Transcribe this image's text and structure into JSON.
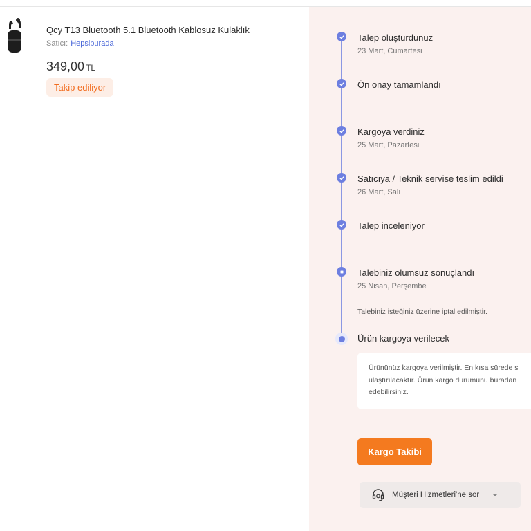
{
  "product": {
    "title": "Qcy T13 Bluetooth 5.1 Bluetooth Kablosuz Kulaklık",
    "seller_label": "Satıcı:",
    "seller_name": "Hepsiburada",
    "price": "349,00",
    "currency": "TL",
    "status_badge": "Takip ediliyor",
    "image_icon": "earbuds-case-icon"
  },
  "timeline": {
    "steps": [
      {
        "title": "Talep oluşturdunuz",
        "date": "23 Mart, Cumartesi",
        "status": "done"
      },
      {
        "title": "Ön onay tamamlandı",
        "date": "",
        "status": "done"
      },
      {
        "title": "Kargoya verdiniz",
        "date": "25 Mart, Pazartesi",
        "status": "done"
      },
      {
        "title": "Satıcıya / Teknik servise teslim edildi",
        "date": "26 Mart, Salı",
        "status": "done"
      },
      {
        "title": "Talep inceleniyor",
        "date": "",
        "status": "done"
      },
      {
        "title": "Talebiniz olumsuz sonuçlandı",
        "date": "25 Nisan, Perşembe",
        "note": "Talebiniz isteğiniz üzerine iptal edilmiştir.",
        "status": "rejected"
      },
      {
        "title": "Ürün kargoya verilecek",
        "status": "current"
      }
    ],
    "info_lines": [
      "Ürününüz kargoya verilmiştir. En kısa sürede s",
      "ulaştırılacaktır. Ürün kargo durumunu buradan",
      "edebilirsiniz."
    ]
  },
  "actions": {
    "cargo_button": "Kargo Takibi",
    "support_button": "Müşteri Hizmetleri'ne sor",
    "support_icon": "headset-icon"
  },
  "colors": {
    "accent_orange": "#f47a1f",
    "timeline_blue": "#6d7fe0",
    "seller_link": "#4a67d8",
    "panel_bg": "#fbf1ef"
  }
}
